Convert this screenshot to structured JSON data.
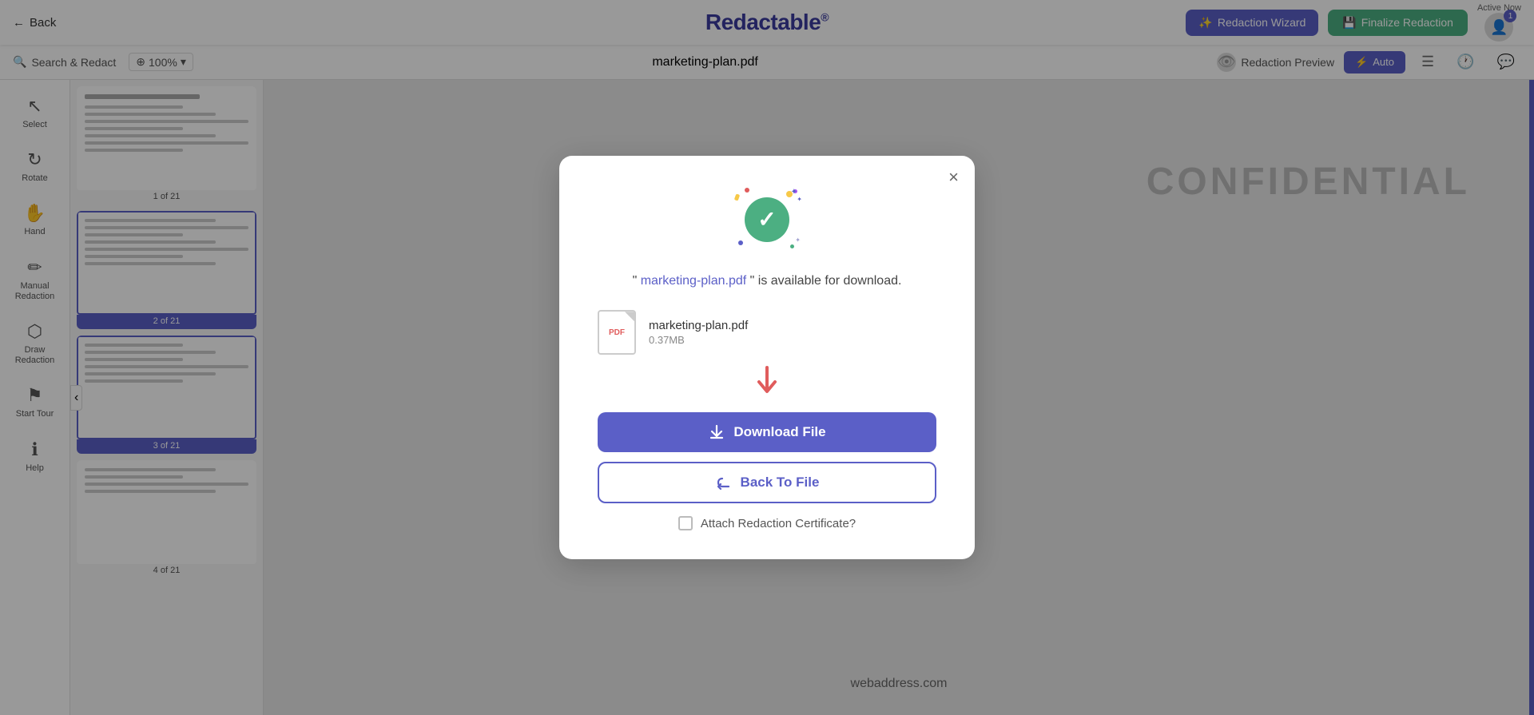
{
  "topbar": {
    "back_label": "Back",
    "logo_text": "Redactable",
    "logo_symbol": "®",
    "wizard_label": "Redaction Wizard",
    "finalize_label": "Finalize Redaction",
    "active_now_label": "Active Now",
    "badge_count": "1"
  },
  "secondbar": {
    "search_label": "Search & Redact",
    "zoom_value": "100%",
    "filename": "marketing-plan.pdf",
    "redaction_preview_label": "Redaction Preview",
    "auto_label": "Auto"
  },
  "tools": [
    {
      "id": "select",
      "icon": "↖",
      "label": "Select"
    },
    {
      "id": "rotate",
      "icon": "↻",
      "label": "Rotate"
    },
    {
      "id": "hand",
      "icon": "✋",
      "label": "Hand"
    },
    {
      "id": "manual-redaction",
      "icon": "✏️",
      "label": "Manual Redaction"
    },
    {
      "id": "draw-redaction",
      "icon": "⬡",
      "label": "Draw Redaction"
    },
    {
      "id": "start-tour",
      "icon": "⚑",
      "label": "Start Tour"
    },
    {
      "id": "help",
      "icon": "ℹ",
      "label": "Help"
    }
  ],
  "thumbnails": [
    {
      "id": "thumb-1",
      "label": "1 of 21",
      "active": false
    },
    {
      "id": "thumb-2",
      "label": "2 of 21",
      "active": true
    },
    {
      "id": "thumb-3",
      "label": "3 of 21",
      "active": false
    },
    {
      "id": "thumb-4",
      "label": "4 of 21",
      "active": false
    }
  ],
  "content": {
    "watermark": "CONFIDENTIAL",
    "webaddress": "webaddress.com"
  },
  "modal": {
    "close_label": "×",
    "filename_link": "marketing-plan.pdf",
    "subtitle_pre": "\" ",
    "subtitle_post": " \" is available for download.",
    "file_name": "marketing-plan.pdf",
    "file_size": "0.37MB",
    "download_label": "Download File",
    "back_to_file_label": "Back To File",
    "cert_label": "Attach Redaction Certificate?"
  }
}
